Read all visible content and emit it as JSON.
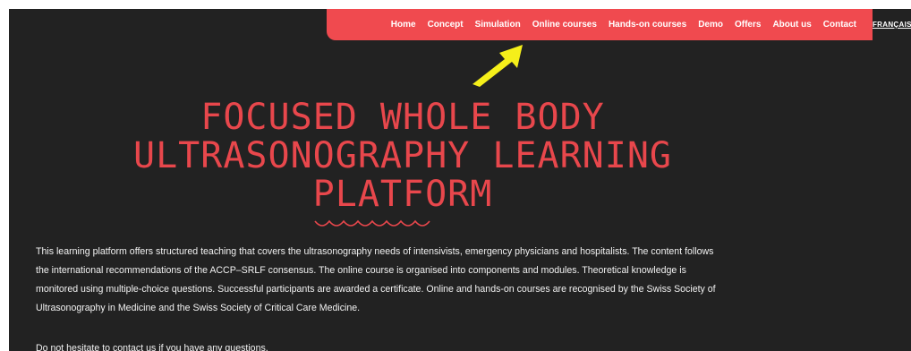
{
  "nav": {
    "items": [
      {
        "label": "Home"
      },
      {
        "label": "Concept"
      },
      {
        "label": "Simulation"
      },
      {
        "label": "Online courses"
      },
      {
        "label": "Hands-on courses"
      },
      {
        "label": "Demo"
      },
      {
        "label": "Offers"
      },
      {
        "label": "About us"
      },
      {
        "label": "Contact"
      }
    ],
    "language": "FRANÇAIS"
  },
  "hero": {
    "title": "FOCUSED WHOLE BODY ULTRASONOGRAPHY LEARNING PLATFORM"
  },
  "intro": {
    "text": "This learning platform offers structured teaching that covers the ultrasonography needs of intensivists, emergency physicians and hospitalists. The content follows the international recommendations of the ACCP–SRLF consensus. The online course is organised into components and modules. Theoretical knowledge is monitored using multiple-choice questions. Successful participants are awarded a certificate. Online and hands-on courses are recognised by the Swiss Society of Ultrasonography in Medicine and the Swiss Society of Critical Care Medicine.",
    "contact": "Do not hesitate to contact us if you have any questions."
  },
  "colors": {
    "background": "#222222",
    "accent": "#f04a4f",
    "title": "#e8474c",
    "annotation_arrow": "#f5ef1a",
    "text": "#f2f2f2"
  },
  "icons": {
    "annotation": "yellow-arrow-icon",
    "divider": "squiggle-divider-icon"
  }
}
